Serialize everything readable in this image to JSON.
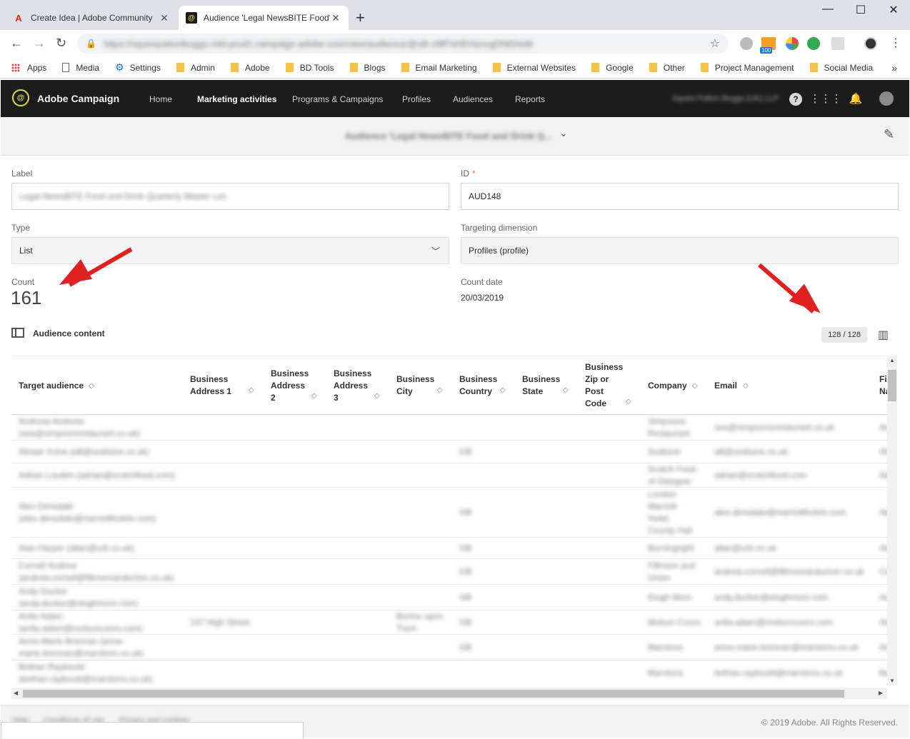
{
  "browser": {
    "tabs": [
      {
        "title": "Create Idea | Adobe Community",
        "favicon": "adobe-icon"
      },
      {
        "title": "Audience 'Legal NewsBITE Food'",
        "favicon": "campaign-icon"
      }
    ],
    "new_tab": "+",
    "window": {
      "minimize": "—",
      "maximize": "☐",
      "close": "✕"
    },
    "url": "https://squirepattonboggs-mkt-prod1.campaign.adobe.com/view/audience/@xB-c8ff7e0EHsnvgDNt5/edit",
    "bookmarks": [
      "Apps",
      "Media",
      "Settings",
      "Admin",
      "Adobe",
      "BD Tools",
      "Blogs",
      "Email Marketing",
      "External Websites",
      "Google",
      "Other",
      "Project Management",
      "Social Media"
    ],
    "ext_badge": "100"
  },
  "app": {
    "name": "Adobe Campaign",
    "nav": [
      "Home",
      "Marketing activities",
      "Programs & Campaigns",
      "Profiles",
      "Audiences",
      "Reports"
    ],
    "active_nav": "Marketing activities",
    "account": "Squire Patton Boggs (UK) LLP"
  },
  "page": {
    "title": "Audience 'Legal NewsBITE Food and Drink Q...",
    "label_label": "Label",
    "label_value": "Legal NewsBITE Food and Drink Quarterly Master List",
    "id_label": "ID",
    "id_required": "*",
    "id_value": "AUD148",
    "type_label": "Type",
    "type_value": "List",
    "targeting_label": "Targeting dimension",
    "targeting_value": "Profiles (profile)",
    "count_label": "Count",
    "count_value": "161",
    "count_date_label": "Count date",
    "count_date_value": "20/03/2019",
    "content_title": "Audience content",
    "pager": "128 / 128"
  },
  "table": {
    "columns": [
      {
        "label": "Target audience"
      },
      {
        "label": "Business Address 1"
      },
      {
        "label": "Business Address 2"
      },
      {
        "label": "Business Address 3"
      },
      {
        "label": "Business City"
      },
      {
        "label": "Business Country"
      },
      {
        "label": "Business State"
      },
      {
        "label": "Business Zip or Post Code"
      },
      {
        "label": "Company"
      },
      {
        "label": "Email"
      },
      {
        "label": "First Name"
      }
    ],
    "rows": [
      {
        "target": "Andreas Andreas (sea@simpsonrestaurant.co.uk)",
        "addr1": "",
        "city": "",
        "country": "",
        "company": "Simpsons Restaurant",
        "email": "sea@simpsonsrestaurant.co.uk",
        "first": "Andreas"
      },
      {
        "target": "Alistair Irvine (alli@sodisine.co.uk)",
        "addr1": "",
        "city": "",
        "country": "GB",
        "company": "Sodisine",
        "email": "alli@sodisine.co.uk",
        "first": "Alistair"
      },
      {
        "target": "Adrian Louden (adrian@scotchfood.com)",
        "addr1": "",
        "city": "",
        "country": "",
        "company": "Scotch Food of Glasgow",
        "email": "adrian@scotchfood.com",
        "first": "Adrian"
      },
      {
        "target": "Alex Dimsdale (alex.dimsdale@marriotthotels.com)",
        "addr1": "",
        "city": "",
        "country": "GB",
        "company": "London Marriott Hotel, County Hall",
        "email": "alex.dimsdale@marriotthotels.com",
        "first": "Alex"
      },
      {
        "target": "Alan Harper (allan@urb.co.uk)",
        "addr1": "",
        "city": "",
        "country": "GB",
        "company": "Burningright",
        "email": "allan@urb.co.uk",
        "first": "Alan"
      },
      {
        "target": "Cornell Andrew (andrew.cornell@fillmoreandunion.co.uk)",
        "addr1": "",
        "city": "",
        "country": "GB",
        "company": "Fillmore and Union",
        "email": "andrew.cornell@fillmoreandunion.co.uk",
        "first": "Cornell"
      },
      {
        "target": "Andy Ducker (andy.ducker@eloghmore.com)",
        "addr1": "",
        "city": "",
        "country": "GB",
        "company": "Elogh More",
        "email": "andy.ducker@eloghmore.com",
        "first": "Andy"
      },
      {
        "target": "Anita Adam (anita.adam@molsoncoors.com)",
        "addr1": "137 High Street",
        "city": "Burton upon Trent",
        "country": "GB",
        "company": "Molson Coors",
        "email": "anita.adam@molsoncoors.com",
        "first": "Anita"
      },
      {
        "target": "Anne-Marie Brennan (anne-marie.brennan@marstons.co.uk)",
        "addr1": "",
        "city": "",
        "country": "GB",
        "company": "Marstons",
        "email": "anne-marie.brennan@marstons.co.uk",
        "first": "Anne-Marie"
      },
      {
        "target": "Bethan Raybould (bethan.raybould@marstons.co.uk)",
        "addr1": "",
        "city": "",
        "country": "",
        "company": "Marstons",
        "email": "bethan.raybould@marstons.co.uk",
        "first": "Bethan"
      }
    ]
  },
  "footer": {
    "links": [
      "Help",
      "Conditions of use",
      "Privacy and cookies"
    ],
    "copyright": "© 2019 Adobe. All Rights Reserved."
  },
  "colors": {
    "annotation_arrow": "#e02020",
    "header_bg": "#1c1c1c",
    "logo": "#e0d94f",
    "required": "#e8742e"
  }
}
